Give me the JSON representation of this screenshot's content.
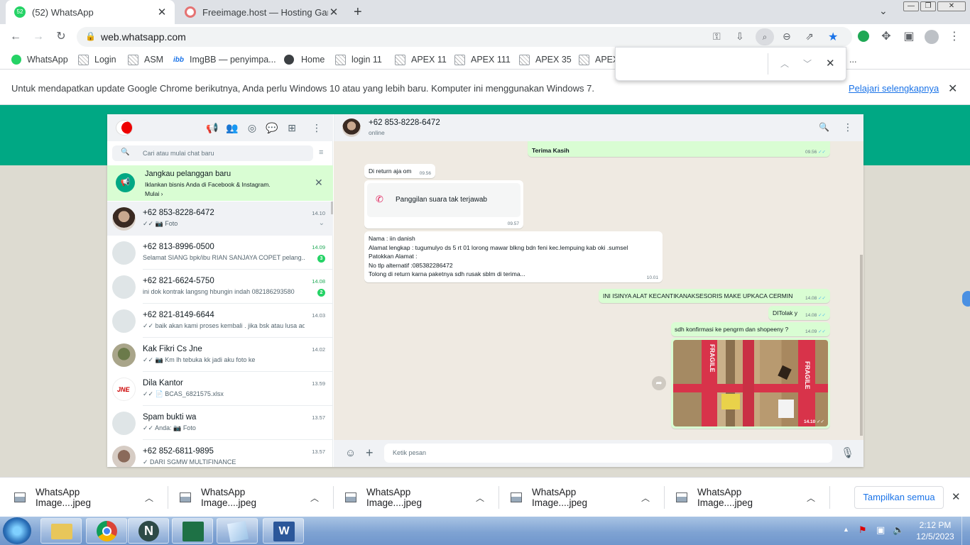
{
  "browser": {
    "tabs": [
      {
        "title": "(52) WhatsApp",
        "badge": "52",
        "active": true
      },
      {
        "title": "Freeimage.host — Hosting Gamb",
        "active": false
      }
    ],
    "new_tab": "+",
    "url": "web.whatsapp.com",
    "bookmarks": [
      "WhatsApp",
      "Login",
      "ASM",
      "ImgBB — penyimpa...",
      "Home",
      "login 11",
      "APEX 11",
      "APEX 111",
      "APEX 35",
      "APEX"
    ],
    "bookmarks_overflow": "...",
    "imgbb_icon": "ibb",
    "findbar": {
      "value": ""
    },
    "infobar": {
      "text": "Untuk mendapatkan update Google Chrome berikutnya, Anda perlu Windows 10 atau yang lebih baru. Komputer ini menggunakan Windows 7.",
      "link": "Pelajari selengkapnya"
    }
  },
  "whatsapp": {
    "search_placeholder": "Cari atau mulai chat baru",
    "banner": {
      "title": "Jangkau pelanggan baru",
      "text": "Iklankan bisnis Anda di Facebook & Instagram.",
      "link": "Mulai"
    },
    "chats": [
      {
        "name": "+62 853-8228-6472",
        "time": "14.10",
        "preview": "✓✓ 📷 Foto",
        "unread": "",
        "selected": true
      },
      {
        "name": "+62 813-8996-0500",
        "time": "14.09",
        "preview": "Selamat SIANG  bpk/ibu RIAN SANJAYA COPET pelang...",
        "unread": "3"
      },
      {
        "name": "+62 821-6624-5750",
        "time": "14.08",
        "preview": "ini dok kontrak langsng hbungin indah 082186293580",
        "unread": "2"
      },
      {
        "name": "+62 821-8149-6644",
        "time": "14.03",
        "preview": "✓✓ baik akan kami proses kembali . jika bsk atau lusa ada  :y...",
        "unread": ""
      },
      {
        "name": "Kak Fikri Cs Jne",
        "time": "14.02",
        "preview": "✓✓ 📷 Km lh tebuka kk jadi aku foto ke",
        "unread": ""
      },
      {
        "name": "Dila Kantor",
        "time": "13.59",
        "preview": "✓✓ 📄 BCAS_6821575.xlsx",
        "unread": ""
      },
      {
        "name": "Spam bukti wa",
        "time": "13.57",
        "preview": "✓✓ Anda: 📷 Foto",
        "unread": ""
      },
      {
        "name": "+62 852-6811-9895",
        "time": "13.57",
        "preview": "✓ DARI SGMW MULTIFINANCE",
        "unread": ""
      }
    ],
    "jne_logo": "JNE",
    "contact": {
      "name": "+62 853-8228-6472",
      "status": "online"
    },
    "messages": {
      "m0_line2": "Terima Kasih",
      "m0_time": "09.56",
      "m1_text": "Di return aja om",
      "m1_time": "09.56",
      "m2_text": "Panggilan suara tak terjawab",
      "m2_time": "09.57",
      "m3_lines": [
        "Nama : iin danish",
        "Alamat  lengkap : tugumulyo ds 5 rt 01 lorong mawar blkng bdn feni kec.lempuing kab oki .sumsel",
        "Patokkan Alamat :",
        "No tlp alternatif :085382286472",
        "Tolong di return karna paketnya sdh rusak sblm di terima..."
      ],
      "m3_time": "10.01",
      "m4_text": "INI ISINYA  ALAT KECANTIKANAKSESORIS MAKE UPKACA  CERMIN",
      "m4_time": "14.08",
      "m5_text": "DITolak  y",
      "m5_time": "14.08",
      "m6_text": "sdh  konfirmasi ke pengrm dan  shopeeny ?",
      "m6_time": "14.09",
      "m7_time": "14.10",
      "m7_image_text": "FRAGILE"
    },
    "composer_placeholder": "Ketik pesan"
  },
  "downloads": {
    "items": [
      "WhatsApp Image....jpeg",
      "WhatsApp Image....jpeg",
      "WhatsApp Image....jpeg",
      "WhatsApp Image....jpeg",
      "WhatsApp Image....jpeg"
    ],
    "show_all": "Tampilkan semua"
  },
  "taskbar": {
    "time": "2:12 PM",
    "date": "12/5/2023",
    "apps": [
      "windows-explorer",
      "chrome",
      "n-app",
      "excel",
      "notepad",
      "word"
    ],
    "letters": {
      "n_app": "N",
      "word": "W"
    }
  },
  "colors": {
    "wa_green": "#00a884",
    "bubble_out": "#d9fdd3",
    "unread": "#25d366"
  }
}
